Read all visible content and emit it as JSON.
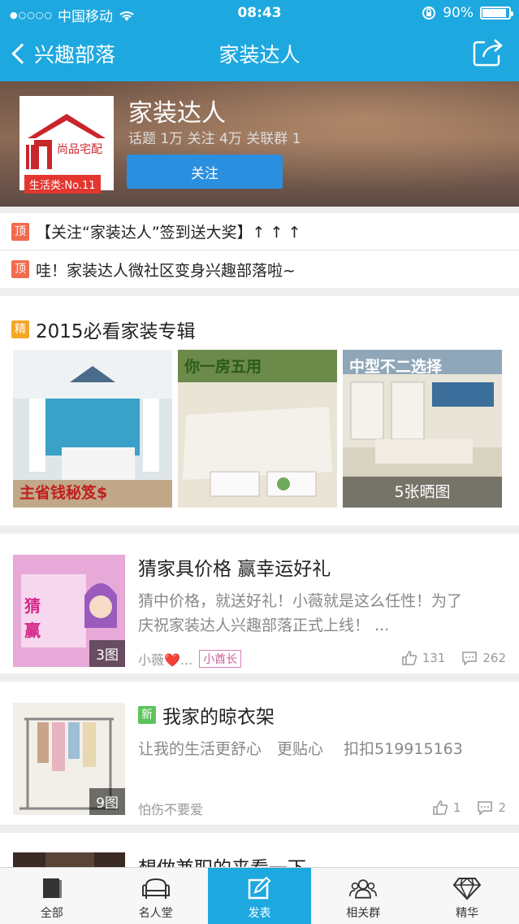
{
  "status_bar": {
    "carrier": "中国移动",
    "time": "08:43",
    "battery": "90%",
    "battery_level": 0.9
  },
  "nav": {
    "back_label": "兴趣部落",
    "title": "家装达人"
  },
  "tribe": {
    "logo_text": "尚品宅配",
    "rank": "生活类:No.11",
    "name": "家装达人",
    "stats": "话题 1万  关注 4万  关联群 1",
    "follow_label": "关注"
  },
  "pinned": [
    {
      "tag": "顶",
      "text": "【关注“家装达人”签到送大奖】↑ ↑ ↑"
    },
    {
      "tag": "顶",
      "text": "哇！家装达人微社区变身兴趣部落啦~"
    }
  ],
  "album": {
    "tag": "精",
    "title": "2015必看家装专辑",
    "thumb1_caption": "主省钱秘笈$",
    "thumb2_caption": "你一房五用",
    "thumb3_caption": "中型不二选择",
    "photo_count": "5张晒图"
  },
  "posts": [
    {
      "title": "猜家具价格 赢幸运好礼",
      "excerpt": "猜中价格，就送好礼！小薇就是这么任性！为了庆祝家装达人兴趣部落正式上线！ ...",
      "author": "小薇❤️...",
      "badge": "小酋长",
      "likes": "131",
      "comments": "262",
      "image_count": "3图"
    },
    {
      "tag": "新",
      "title": "我家的晾衣架",
      "excerpt": "让我的生活更舒心　更贴心　 扣扣519915163",
      "author": "怕伤不要爱",
      "likes": "1",
      "comments": "2",
      "image_count": "9图"
    },
    {
      "title": "想做兼职的来看一下"
    }
  ],
  "tabs": [
    {
      "label": "全部",
      "icon": "all-icon"
    },
    {
      "label": "名人堂",
      "icon": "sofa-icon"
    },
    {
      "label": "发表",
      "icon": "compose-icon"
    },
    {
      "label": "相关群",
      "icon": "group-icon"
    },
    {
      "label": "精华",
      "icon": "diamond-icon"
    }
  ],
  "colors": {
    "accent": "#1ea8e0",
    "follow_button": "#2b8fe0",
    "top_tag": "#f26b4f",
    "jing_tag": "#f5a623",
    "new_tag": "#5cc45c"
  }
}
